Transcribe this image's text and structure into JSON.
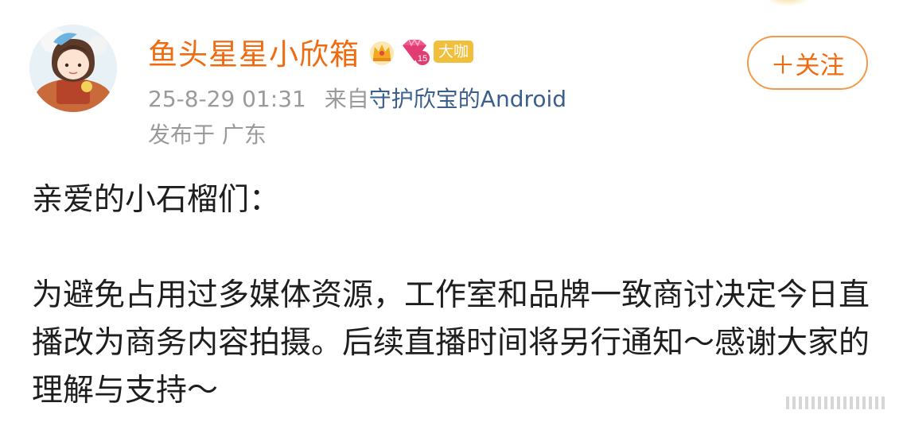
{
  "post": {
    "username": "鱼头星星小欣箱",
    "vip_badge": "大咖",
    "level_badge": "15",
    "timestamp": "25-8-29 01:31",
    "source_prefix": "来自",
    "source_device": "守护欣宝的Android",
    "location": "发布于 广东",
    "follow_label": "＋关注",
    "body": {
      "greeting": "亲爱的小石榴们：",
      "message": "为避免占用过多媒体资源，工作室和品牌一致商讨决定今日直播改为商务内容拍摄。后续直播时间将另行通知～感谢大家的理解与支持～"
    }
  },
  "colors": {
    "username": "#f06b10",
    "link": "#3b5f8c",
    "meta": "#9a9a9a",
    "badge": "#f2bf3c",
    "follow_border": "#f29a4a"
  },
  "icons": {
    "crown": "crown-icon",
    "gem": "gem-level-icon",
    "more": "more-dots-icon"
  }
}
